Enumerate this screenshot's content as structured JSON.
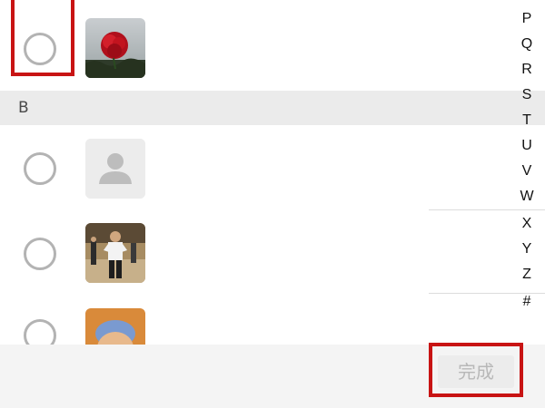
{
  "section_header": {
    "letter": "B"
  },
  "contacts": [
    {
      "selected": false,
      "avatar": "rose-photo-icon"
    },
    {
      "selected": false,
      "avatar": "default-person-icon"
    },
    {
      "selected": false,
      "avatar": "person-photo-icon"
    },
    {
      "selected": false,
      "avatar": "portrait-photo-icon"
    }
  ],
  "index_bar": {
    "letters": [
      "P",
      "Q",
      "R",
      "S",
      "T",
      "U",
      "V",
      "W",
      "X",
      "Y",
      "Z",
      "#"
    ]
  },
  "footer": {
    "done_label": "完成"
  },
  "colors": {
    "highlight": "#c81414",
    "disabled_text": "#b8b8b8",
    "section_bg": "#ebebeb"
  }
}
